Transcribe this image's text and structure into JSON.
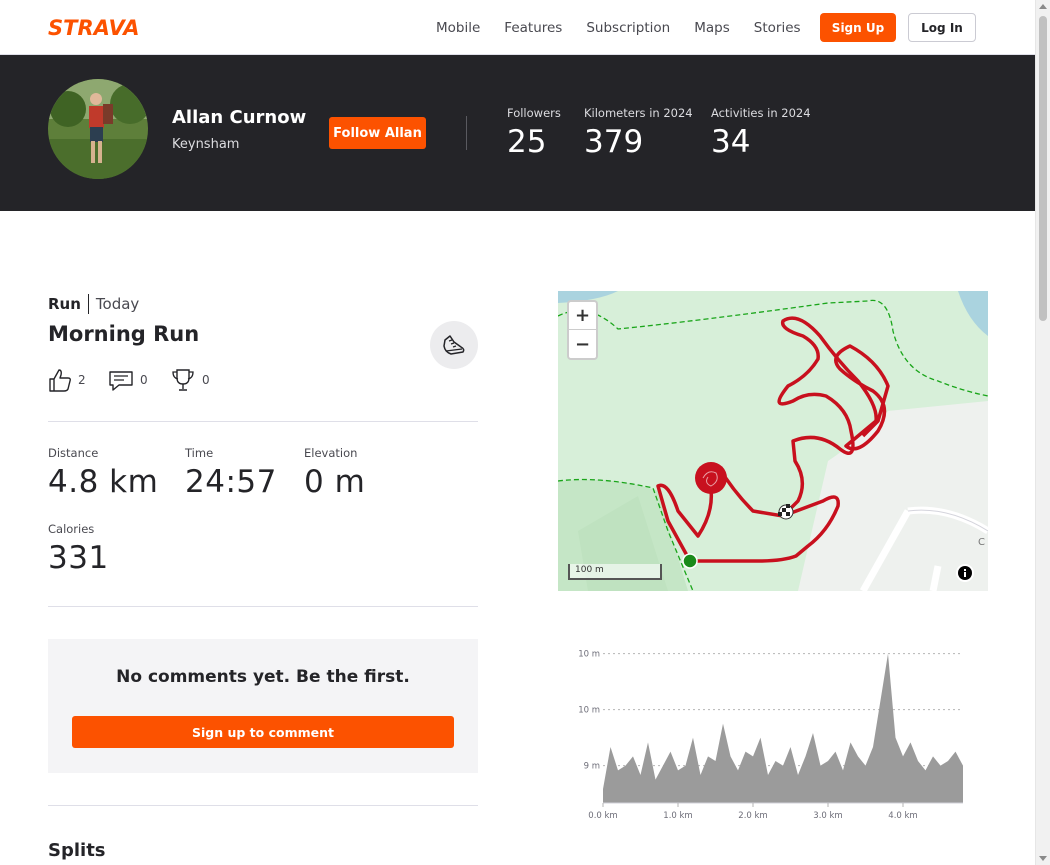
{
  "brand": {
    "name": "STRAVA",
    "accent": "#fc5200",
    "dark": "#242428"
  },
  "nav": {
    "links": [
      "Mobile",
      "Features",
      "Subscription",
      "Maps",
      "Stories"
    ],
    "signup_label": "Sign Up",
    "login_label": "Log In"
  },
  "athlete": {
    "name": "Allan Curnow",
    "location": "Keynsham",
    "follow_label": "Follow Allan",
    "stats": [
      {
        "label": "Followers",
        "value": "25"
      },
      {
        "label": "Kilometers in 2024",
        "value": "379"
      },
      {
        "label": "Activities in 2024",
        "value": "34"
      }
    ]
  },
  "activity": {
    "type": "Run",
    "when": "Today",
    "title": "Morning Run",
    "kudos": "2",
    "comments": "0",
    "achievements": "0",
    "metrics": {
      "distance": {
        "label": "Distance",
        "value": "4.8 km"
      },
      "time": {
        "label": "Time",
        "value": "24:57"
      },
      "elevation": {
        "label": "Elevation",
        "value": "0 m"
      },
      "calories": {
        "label": "Calories",
        "value": "331"
      }
    },
    "comments_empty": "No comments yet. Be the first.",
    "comment_button": "Sign up to comment",
    "splits_title": "Splits"
  },
  "map": {
    "zoom_in": "+",
    "zoom_out": "−",
    "scale_label": "100 m",
    "info": "i",
    "route_color": "#c8101e",
    "start_color": "#1a8a1a"
  },
  "chart_data": {
    "type": "area",
    "title": "",
    "xlabel": "",
    "ylabel": "",
    "xlim": [
      0,
      4.8
    ],
    "ylim": [
      8.6,
      10.4
    ],
    "x_ticks": [
      "0.0 km",
      "1.0 km",
      "2.0 km",
      "3.0 km",
      "4.0 km"
    ],
    "x_tick_values": [
      0,
      1,
      2,
      3,
      4
    ],
    "y_ticks": [
      "9 m",
      "10 m",
      "10 m"
    ],
    "y_tick_values": [
      9.0,
      9.6,
      10.2
    ],
    "fill_color": "#9b9b9b",
    "grid": true,
    "x": [
      0.0,
      0.1,
      0.2,
      0.3,
      0.4,
      0.5,
      0.6,
      0.7,
      0.8,
      0.9,
      1.0,
      1.1,
      1.2,
      1.3,
      1.4,
      1.5,
      1.6,
      1.7,
      1.8,
      1.9,
      2.0,
      2.1,
      2.2,
      2.3,
      2.4,
      2.5,
      2.6,
      2.7,
      2.8,
      2.9,
      3.0,
      3.1,
      3.2,
      3.3,
      3.4,
      3.5,
      3.6,
      3.7,
      3.8,
      3.9,
      4.0,
      4.1,
      4.2,
      4.3,
      4.4,
      4.5,
      4.6,
      4.7,
      4.8
    ],
    "y": [
      8.75,
      9.2,
      8.95,
      9.0,
      9.1,
      8.9,
      9.25,
      8.85,
      9.0,
      9.15,
      8.95,
      9.0,
      9.3,
      8.9,
      9.1,
      9.05,
      9.45,
      9.1,
      8.95,
      9.15,
      9.1,
      9.3,
      8.9,
      9.05,
      9.0,
      9.2,
      8.9,
      9.1,
      9.35,
      9.0,
      9.05,
      9.15,
      8.95,
      9.25,
      9.1,
      9.0,
      9.2,
      9.7,
      10.2,
      9.3,
      9.1,
      9.25,
      9.05,
      8.95,
      9.1,
      9.0,
      9.05,
      9.15,
      9.0
    ]
  }
}
